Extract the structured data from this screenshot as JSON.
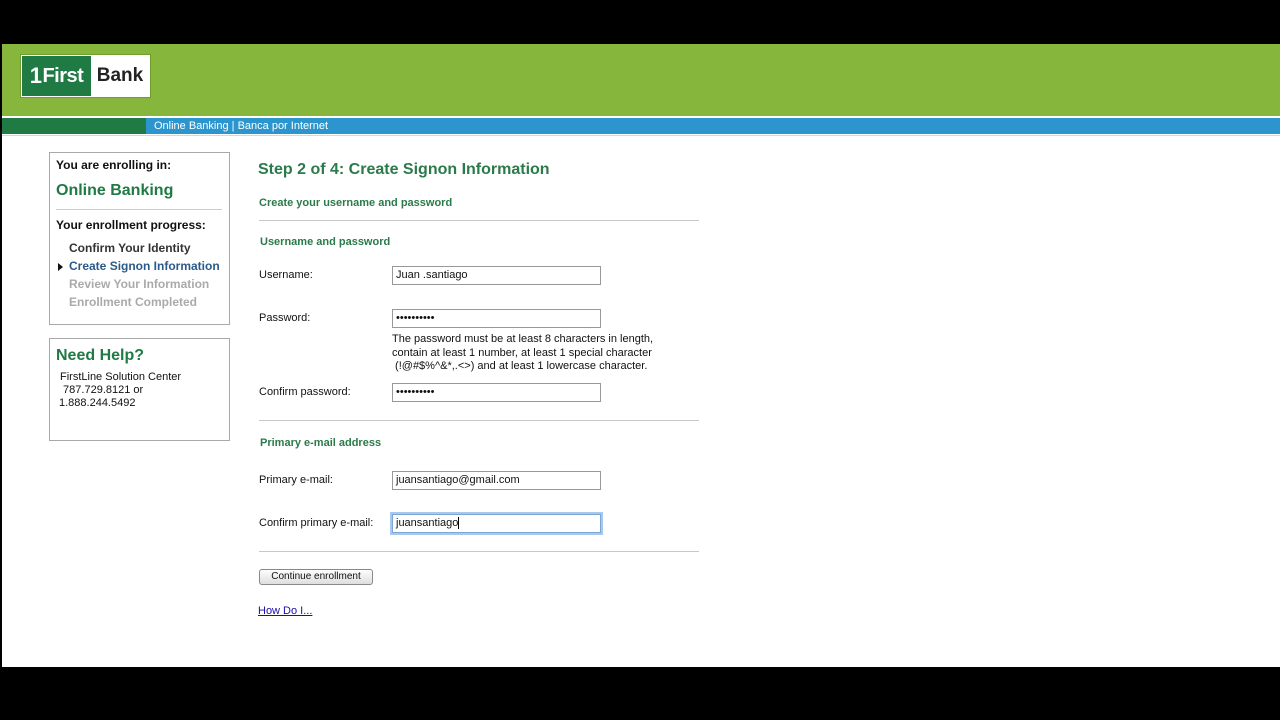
{
  "header": {
    "logo_number": "1",
    "logo_first": "First",
    "logo_bank": "Bank",
    "nav_text": "Online Banking | Banca por Internet"
  },
  "sidebar": {
    "enrolling_label": "You are enrolling in:",
    "enrolling_product": "Online Banking",
    "progress_label": "Your enrollment progress:",
    "steps": [
      {
        "label": "Confirm Your Identity",
        "state": "done"
      },
      {
        "label": "Create Signon Information",
        "state": "current"
      },
      {
        "label": "Review Your Information",
        "state": "todo"
      },
      {
        "label": "Enrollment Completed",
        "state": "todo"
      }
    ],
    "help_title": "Need Help?",
    "help_line1": "FirstLine Solution Center",
    "help_line2": " 787.729.8121 or",
    "help_line3": "1.888.244.5492"
  },
  "main": {
    "title": "Step 2 of 4: Create Signon Information",
    "subtitle": "Create your username and password",
    "section_credentials": "Username and password",
    "username_label": "Username:",
    "username_value": "Juan .santiago",
    "password_label": "Password:",
    "password_value": "••••••••••",
    "password_note": "The password must be at least 8 characters in length,\ncontain at least 1 number, at least 1 special character\n (!@#$%^&*,.<>) and at least 1 lowercase character.",
    "confirm_password_label": "Confirm password:",
    "confirm_password_value": "••••••••••",
    "section_email": "Primary e-mail address",
    "email_label": "Primary e-mail:",
    "email_value": "juansantiago@gmail.com",
    "confirm_email_label": "Confirm primary e-mail:",
    "confirm_email_value": "juansantiago",
    "continue_button": "Continue enrollment",
    "how_do_i": "How Do I..."
  },
  "colors": {
    "brand_green": "#1f7a44",
    "header_green": "#86b73c",
    "nav_blue": "#2c95cd"
  }
}
